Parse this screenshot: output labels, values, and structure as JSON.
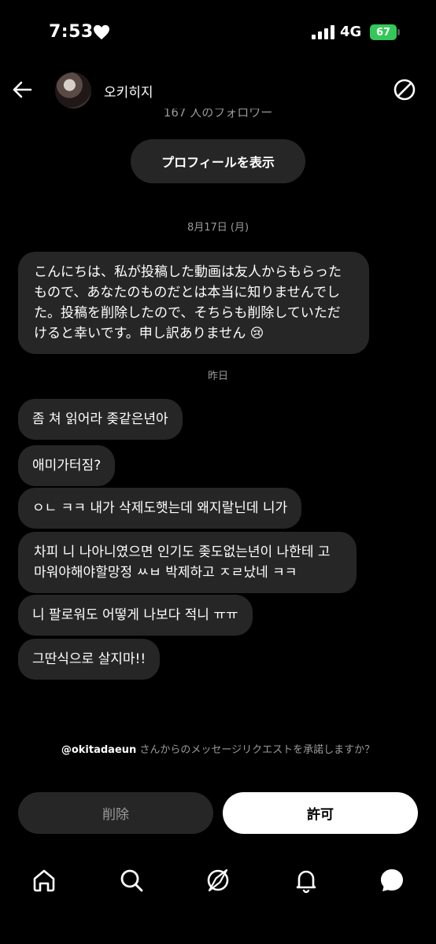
{
  "status_bar": {
    "time": "7:53",
    "network": "4G",
    "battery": "67"
  },
  "header": {
    "name": "오키히지"
  },
  "profile": {
    "followers_text": "167 人のフォロワー",
    "view_profile_label": "プロフィールを表示"
  },
  "messages": {
    "date_1": "8月17日 (月)",
    "msg_1": "こんにちは、私が投稿した動画は友人からもらったもので、あなたのものだとは本当に知りませんでした。投稿を削除したので、そちらも削除していただけると幸いです。申し訳ありません 😢",
    "date_2": "昨日",
    "msg_2": "좀 쳐 읽어라 좆같은년아",
    "msg_3": "애미가터짐?",
    "msg_4": "ㅇㄴ ㅋㅋ 내가 삭제도햇는데 왜지랄닌데 니가",
    "msg_5": "차피 니 나아니였으면 인기도 좆도없는년이 나한테 고마워야해야할망정 ㅆㅂ 박제하고 ㅈㄹ났네 ㅋㅋ",
    "msg_6": "니 팔로워도 어떻게 나보다 적니 ㅠㅠ",
    "msg_7": "그딴식으로 살지마!!"
  },
  "request": {
    "username": "@okitadaeun",
    "text": " さんからのメッセージリクエストを承諾しますか？"
  },
  "actions": {
    "delete_label": "削除",
    "allow_label": "許可"
  },
  "nav": [
    "home-icon",
    "search-icon",
    "explore-icon",
    "notifications-icon",
    "messages-icon"
  ]
}
